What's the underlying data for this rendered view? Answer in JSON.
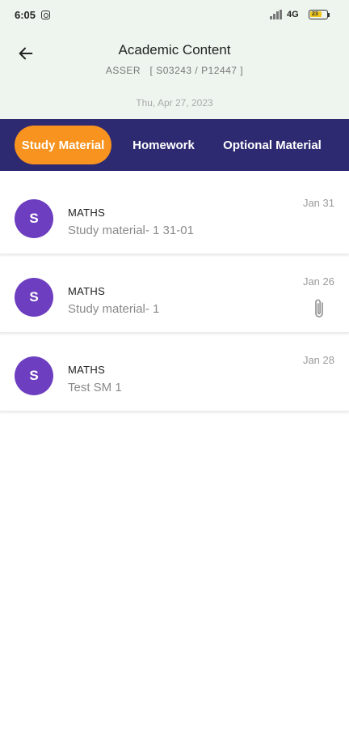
{
  "status_bar": {
    "time": "6:05",
    "network": "4G",
    "battery_level": "23"
  },
  "header": {
    "title": "Academic Content",
    "subtitle": "ASSER   [ S03243 / P12447 ]",
    "date": "Thu, Apr 27, 2023"
  },
  "tabs": [
    {
      "label": "Study Material",
      "active": true
    },
    {
      "label": "Homework",
      "active": false
    },
    {
      "label": "Optional Material",
      "active": false
    }
  ],
  "items": [
    {
      "avatar": "S",
      "subject": "MATHS",
      "title": "Study material- 1 31-01",
      "date": "Jan 31",
      "has_attachment": false
    },
    {
      "avatar": "S",
      "subject": "MATHS",
      "title": "Study material- 1",
      "date": "Jan 26",
      "has_attachment": true
    },
    {
      "avatar": "S",
      "subject": "MATHS",
      "title": "Test SM 1",
      "date": "Jan 28",
      "has_attachment": false
    }
  ],
  "colors": {
    "header_bg": "#eef5ee",
    "tab_bar_bg": "#2e2a72",
    "active_tab": "#f7931e",
    "avatar": "#6d3fc0"
  },
  "icons": {
    "back": "arrow-left-icon",
    "attachment": "paperclip-icon"
  }
}
